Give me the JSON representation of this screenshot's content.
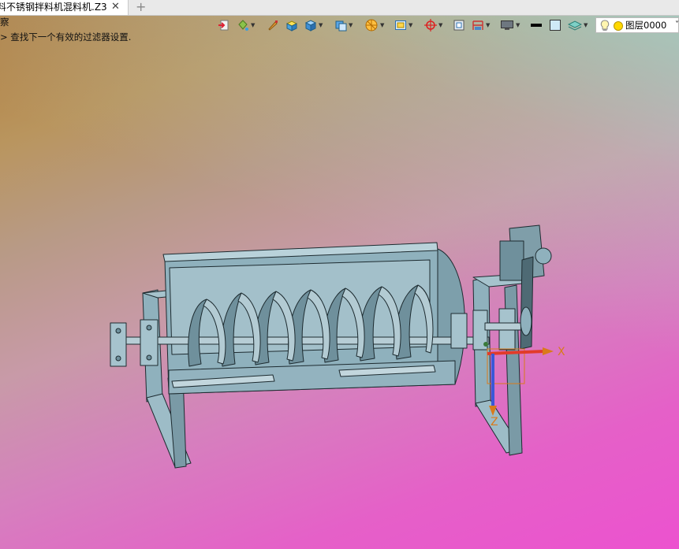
{
  "tab": {
    "title": "料不锈钢拌料机混料机.Z3",
    "close": "✕",
    "add": "+"
  },
  "messages": {
    "line1": "察",
    "line2": "> 查找下一个有效的过滤器设置."
  },
  "toolbar": {
    "icons": [
      "exit-icon",
      "paint-bucket-icon",
      "brush-icon",
      "block-solid-icon",
      "cube-icon",
      "view-cube-icon",
      "render-mode-icon",
      "frame-icon",
      "target-icon",
      "section-icon",
      "dimension-icon",
      "monitor-icon",
      "line-width-icon",
      "color-box-icon",
      "layer-stack-icon"
    ],
    "layer_name": "图层0000",
    "layer_dropdown": "˅"
  },
  "triad": {
    "x_label": "X",
    "z_label": "Z"
  },
  "colors": {
    "model_fill": "#8fb1bd",
    "model_dark": "#5e7d89",
    "model_edge": "#1d2b30",
    "axis_x": "#e23b2a",
    "axis_z": "#3a58d8",
    "triad_label": "#d97a1a"
  }
}
